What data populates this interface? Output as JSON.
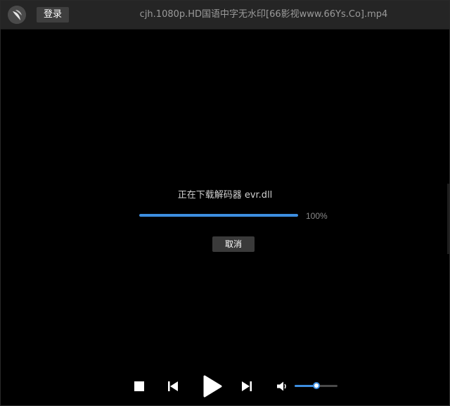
{
  "titlebar": {
    "login_label": "登录",
    "file_title": "cjh.1080p.HD国语中字无水印[66影视www.66Ys.Co].mp4"
  },
  "download": {
    "message": "正在下载解码器 evr.dll",
    "progress": 1.0,
    "progress_text": "100%",
    "cancel_label": "取消"
  },
  "controls": {
    "icons": [
      "stop-icon",
      "previous-icon",
      "play-icon",
      "next-icon",
      "volume-icon"
    ],
    "volume_level": 0.5
  },
  "colors": {
    "accent": "#3d8ee0",
    "titlebar_bg": "#252525",
    "video_bg": "#000000"
  }
}
